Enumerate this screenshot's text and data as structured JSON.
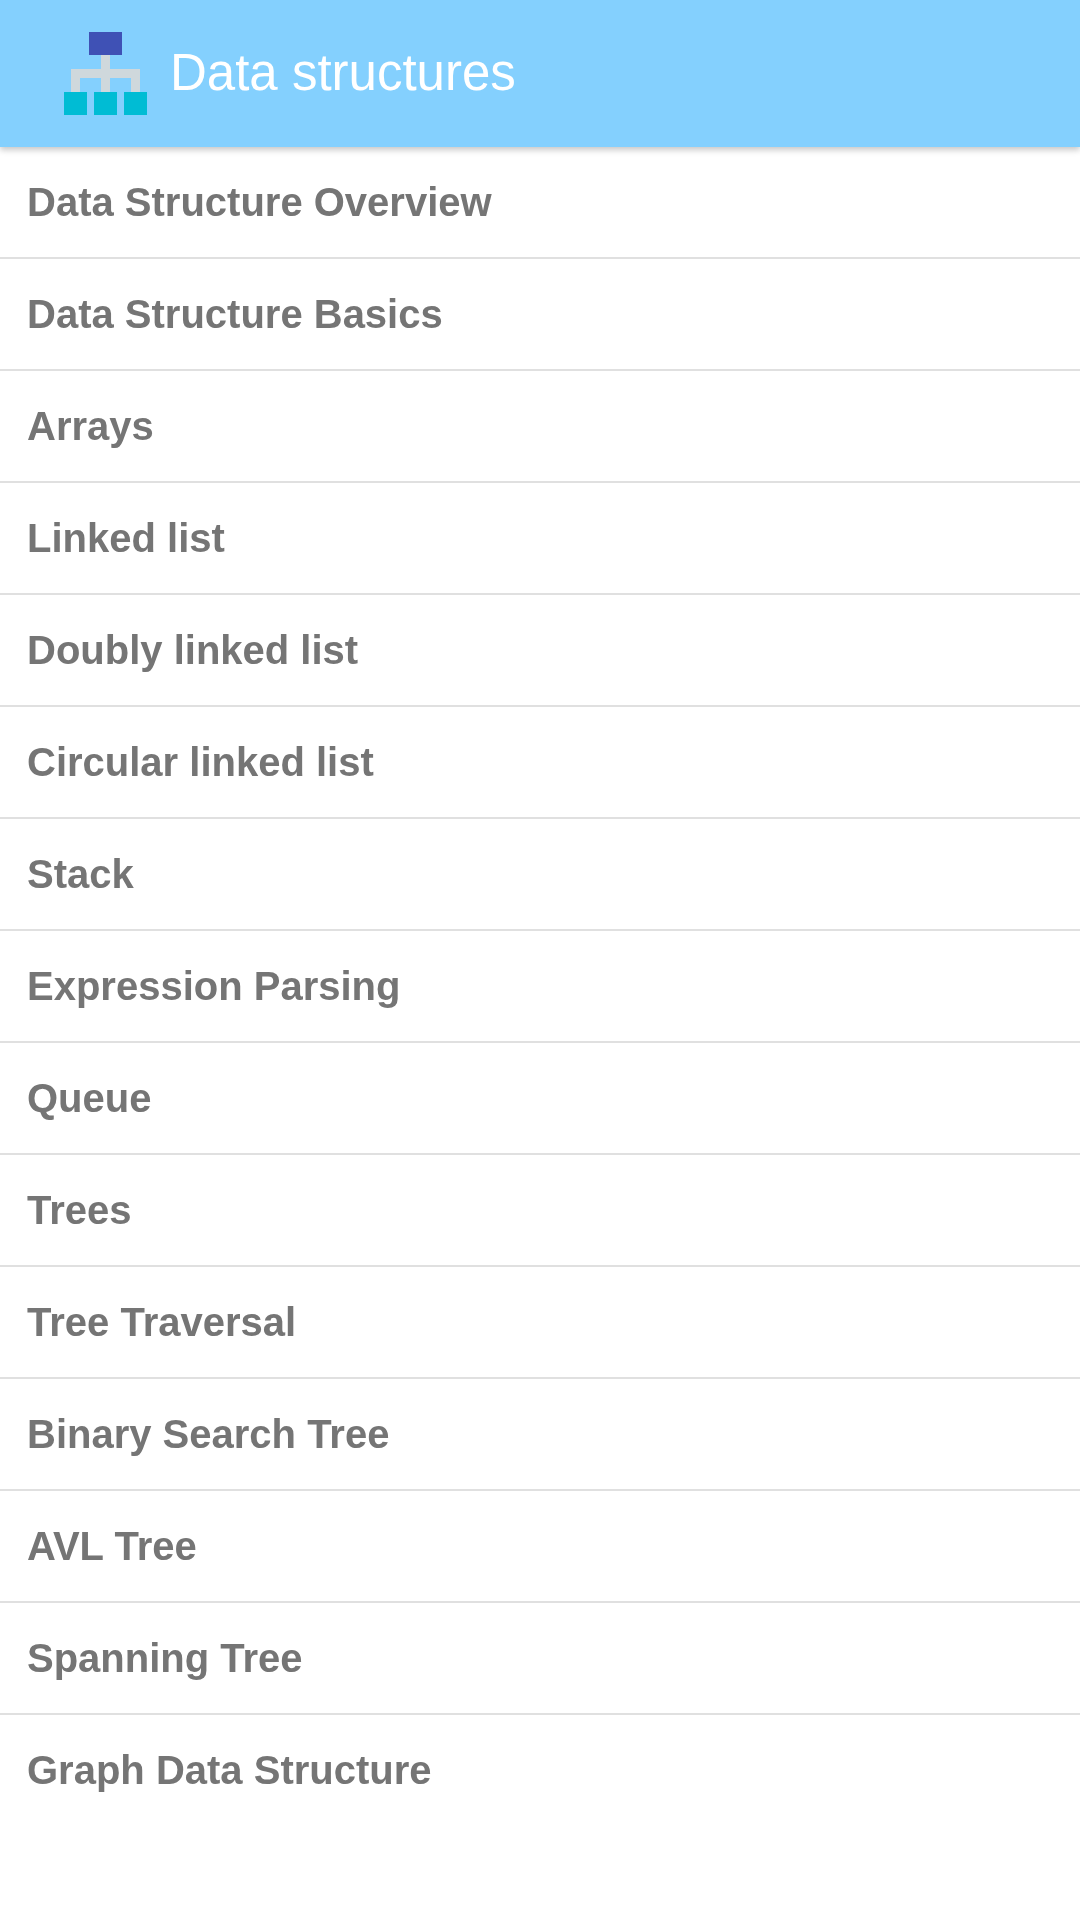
{
  "app_bar": {
    "title": "Data structures"
  },
  "topics": [
    "Data Structure Overview",
    "Data Structure Basics",
    "Arrays",
    "Linked list",
    "Doubly linked list",
    "Circular linked list",
    "Stack",
    "Expression Parsing",
    "Queue",
    "Trees",
    "Tree Traversal",
    "Binary Search Tree",
    "AVL Tree",
    "Spanning Tree",
    "Graph Data Structure"
  ]
}
